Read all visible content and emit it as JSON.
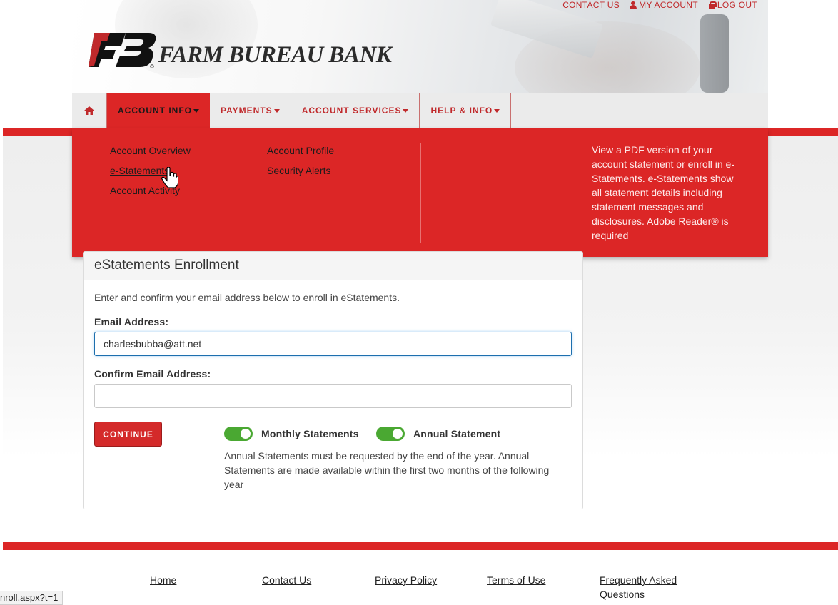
{
  "brand": {
    "name": "FARM BUREAU BANK",
    "logo_mark": "FB",
    "colors": {
      "red": "#dc2626",
      "dark_red": "#c0292b",
      "green_toggle": "#4aa832"
    }
  },
  "top_links": {
    "contact": "CONTACT US",
    "my_account": "MY ACCOUNT",
    "log_out": "LOG OUT"
  },
  "nav": {
    "home_icon": "home-icon",
    "items": [
      {
        "label": "ACCOUNT INFO",
        "active": true
      },
      {
        "label": "PAYMENTS",
        "active": false
      },
      {
        "label": "ACCOUNT SERVICES",
        "active": false
      },
      {
        "label": "HELP & INFO",
        "active": false
      }
    ]
  },
  "dropdown": {
    "col1": [
      "Account Overview",
      "e-Statements",
      "Account Activity"
    ],
    "col2": [
      "Account Profile",
      "Security Alerts"
    ],
    "description": "View a PDF version of your account statement or enroll in e-Statements. e-Statements show all statement details including statement messages and disclosures. Adobe Reader® is required"
  },
  "enrollment": {
    "title": "eStatements Enrollment",
    "intro": "Enter and confirm your email address below to enroll in eStatements.",
    "email_label": "Email Address:",
    "email_value": "charlesbubba@att.net",
    "confirm_label": "Confirm Email Address:",
    "confirm_value": "",
    "continue_label": "CONTINUE",
    "toggle_monthly": {
      "label": "Monthly Statements",
      "on": true
    },
    "toggle_annual": {
      "label": "Annual Statement",
      "on": true
    },
    "note": "Annual Statements must be requested by the end of the year. Annual Statements are made available within the first two months of the following year"
  },
  "footer": {
    "links": [
      "Home",
      "Contact Us",
      "Privacy Policy",
      "Terms of Use",
      "Frequently Asked Questions"
    ]
  },
  "status_bar": {
    "url": "nroll.aspx?t=1"
  }
}
